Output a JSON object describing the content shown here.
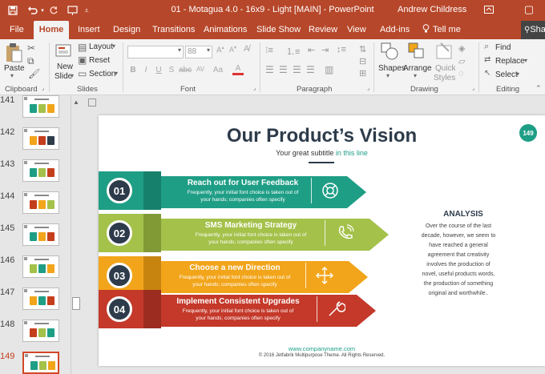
{
  "titlebar": {
    "doc_title": "01 - Motagua 4.0 - 16x9 - Light [MAIN]  -  PowerPoint",
    "user": "Andrew Childress",
    "restore_glyph": "▢"
  },
  "tabs": [
    {
      "label": "File"
    },
    {
      "label": "Home"
    },
    {
      "label": "Insert"
    },
    {
      "label": "Design"
    },
    {
      "label": "Transitions"
    },
    {
      "label": "Animations"
    },
    {
      "label": "Slide Show"
    },
    {
      "label": "Review"
    },
    {
      "label": "View"
    },
    {
      "label": "Add-ins"
    },
    {
      "label": "Tell me"
    }
  ],
  "share_label": "Sha",
  "ribbon": {
    "clipboard": {
      "paste": "Paste",
      "group": "Clipboard"
    },
    "slides": {
      "new_slide_1": "New",
      "new_slide_2": "Slide",
      "layout": "Layout",
      "reset": "Reset",
      "section": "Section",
      "group": "Slides"
    },
    "font": {
      "font_name": "",
      "font_size": "88",
      "group": "Font"
    },
    "paragraph": {
      "group": "Paragraph"
    },
    "drawing": {
      "shapes": "Shapes",
      "arrange": "Arrange",
      "quick": "Quick",
      "styles": "Styles",
      "group": "Drawing"
    },
    "editing": {
      "find": "Find",
      "replace": "Replace",
      "select": "Select",
      "group": "Editing"
    }
  },
  "thumbnails": [
    {
      "num": "141",
      "colors": [
        "#1f9e86",
        "#a4c14a",
        "#f2a51a"
      ]
    },
    {
      "num": "142",
      "colors": [
        "#f2a51a",
        "#c43e1c",
        "#2d3b4a"
      ]
    },
    {
      "num": "143",
      "colors": [
        "#1f9e86",
        "#a4c14a",
        "#c43e1c"
      ]
    },
    {
      "num": "144",
      "colors": [
        "#c43e1c",
        "#f2a51a",
        "#a4c14a"
      ]
    },
    {
      "num": "145",
      "colors": [
        "#1f9e86",
        "#f2a51a",
        "#c43e1c"
      ]
    },
    {
      "num": "146",
      "colors": [
        "#a4c14a",
        "#1f9e86",
        "#f2a51a"
      ]
    },
    {
      "num": "147",
      "colors": [
        "#f2a51a",
        "#1f9e86",
        "#c43e1c"
      ]
    },
    {
      "num": "148",
      "colors": [
        "#c43e1c",
        "#a4c14a",
        "#1f9e86"
      ]
    },
    {
      "num": "149",
      "colors": [
        "#1f9e86",
        "#a4c14a",
        "#f2a51a"
      ]
    }
  ],
  "slide": {
    "title": "Our Product’s Vision",
    "subtitle_a": "Your great subtitle ",
    "subtitle_b": "in this line",
    "page_number": "149",
    "bands": [
      {
        "num": "01",
        "head": "Reach out for User Feedback",
        "text1": "Frequently, your initial font choice is taken out of",
        "text2": "your hands; companies often specify",
        "color": "#1f9e86",
        "dark": "#17806c",
        "icon": "lifebuoy-icon"
      },
      {
        "num": "02",
        "head": "SMS Marketing Strategy",
        "text1": "Frequently, your initial font choice is taken out of",
        "text2": "your hands; companies often specify",
        "color": "#a4c14a",
        "dark": "#829a35",
        "icon": "phone-icon"
      },
      {
        "num": "03",
        "head": "Choose a new Direction",
        "text1": "Frequently, your initial font choice is taken out of",
        "text2": "your hands; companies often specify",
        "color": "#f2a51a",
        "dark": "#c78510",
        "icon": "move-arrows-icon"
      },
      {
        "num": "04",
        "head": "Implement Consistent Upgrades",
        "text1": "Frequently, your initial font choice is taken out of",
        "text2": "your hands; companies often specify",
        "color": "#c4392a",
        "dark": "#9c2c20",
        "icon": "wrench-icon"
      }
    ],
    "analysis_title": "ANALYSIS",
    "analysis_lines": [
      "Over the course of the last",
      "decade, however, we seem to",
      "have reached a general",
      "agreement that creativity",
      "involves the production of",
      "novel, useful products words,",
      "the production of something",
      "original and worthwhile.."
    ],
    "footer_url": "www.companyname.com",
    "footer_copy": "© 2016 Jetfabrik Multipurpose Theme. All Rights Reserved."
  }
}
